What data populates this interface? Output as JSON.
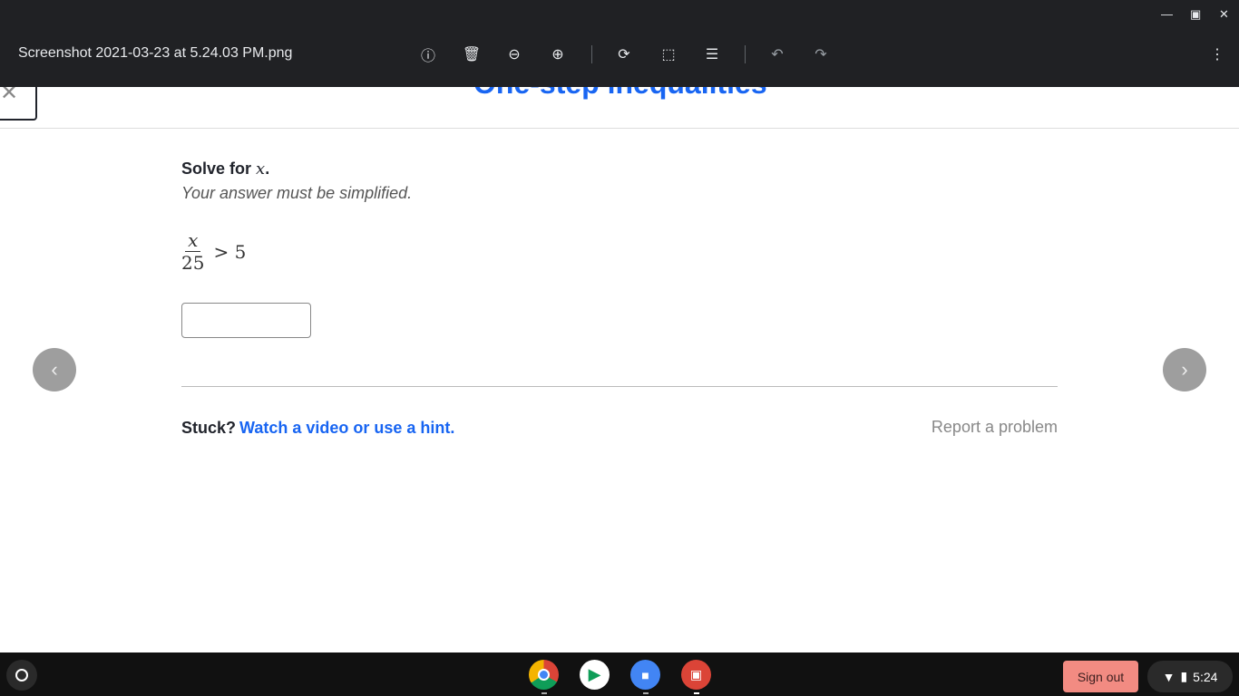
{
  "window": {
    "title": "Screenshot 2021-03-23 at 5.24.03 PM.png"
  },
  "page": {
    "heading": "One-step inequalities",
    "prompt": "Solve for",
    "variable": "x",
    "period": ".",
    "instruction": "Your answer must be simplified.",
    "numerator": "x",
    "denominator": "25",
    "relation": "> 5",
    "answer_value": "",
    "stuck_label": "Stuck?",
    "hint_link": "Watch a video or use a hint.",
    "report_link": "Report a problem"
  },
  "shelf": {
    "sign_out": "Sign out",
    "time": "5:24"
  }
}
